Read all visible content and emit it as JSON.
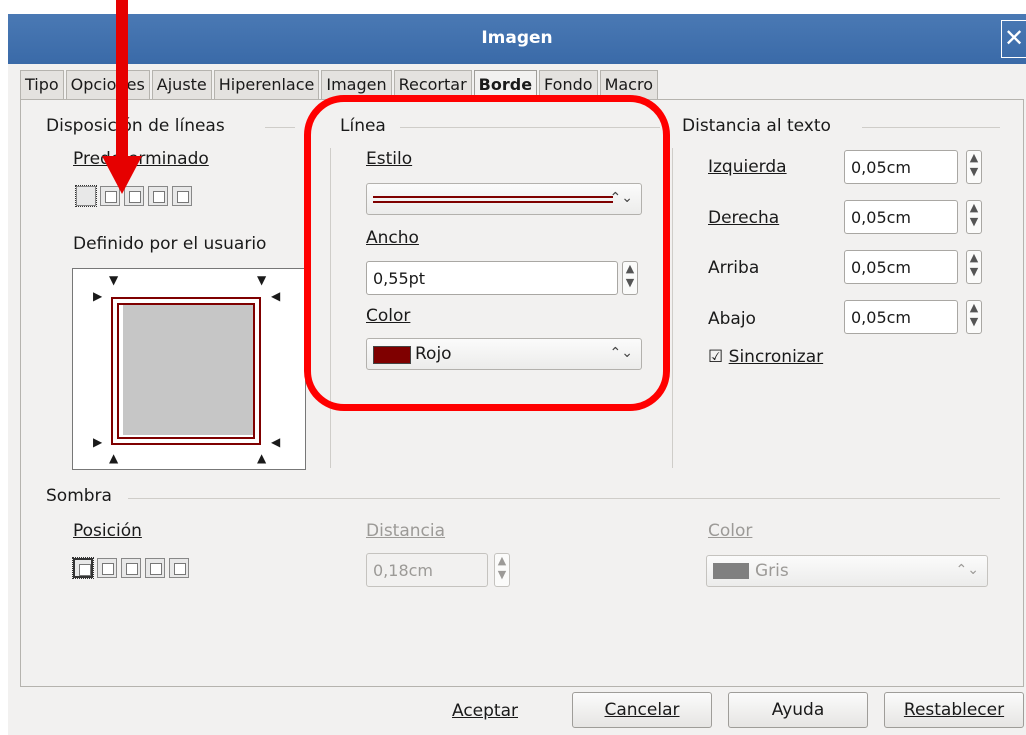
{
  "window": {
    "title": "Imagen"
  },
  "tabs": [
    "Tipo",
    "Opciones",
    "Ajuste",
    "Hiperenlace",
    "Imagen",
    "Recortar",
    "Borde",
    "Fondo",
    "Macro"
  ],
  "active_tab": "Borde",
  "line_arrangement": {
    "legend": "Disposición de líneas",
    "preset_label": "Predeterminado",
    "user_defined_label": "Definido por el usuario"
  },
  "line": {
    "legend": "Línea",
    "style_label": "Estilo",
    "width_label": "Ancho",
    "width_value": "0,55pt",
    "color_label": "Color",
    "color_value": "Rojo",
    "color_hex": "#7f0000"
  },
  "spacing": {
    "legend": "Distancia al texto",
    "left_label": "Izquierda",
    "left_value": "0,05cm",
    "right_label": "Derecha",
    "right_value": "0,05cm",
    "top_label": "Arriba",
    "top_value": "0,05cm",
    "bottom_label": "Abajo",
    "bottom_value": "0,05cm",
    "sync_label": "Sincronizar",
    "sync_checked": true
  },
  "shadow": {
    "legend": "Sombra",
    "position_label": "Posición",
    "distance_label": "Distancia",
    "distance_value": "0,18cm",
    "color_label": "Color",
    "color_value": "Gris",
    "color_hex": "#808080"
  },
  "buttons": {
    "ok": "Aceptar",
    "cancel": "Cancelar",
    "help": "Ayuda",
    "reset": "Restablecer"
  },
  "icons": {
    "close": "close-icon",
    "spin": "spin-updown-icon",
    "combo": "combo-updown-icon",
    "check": "checkbox-icon"
  }
}
